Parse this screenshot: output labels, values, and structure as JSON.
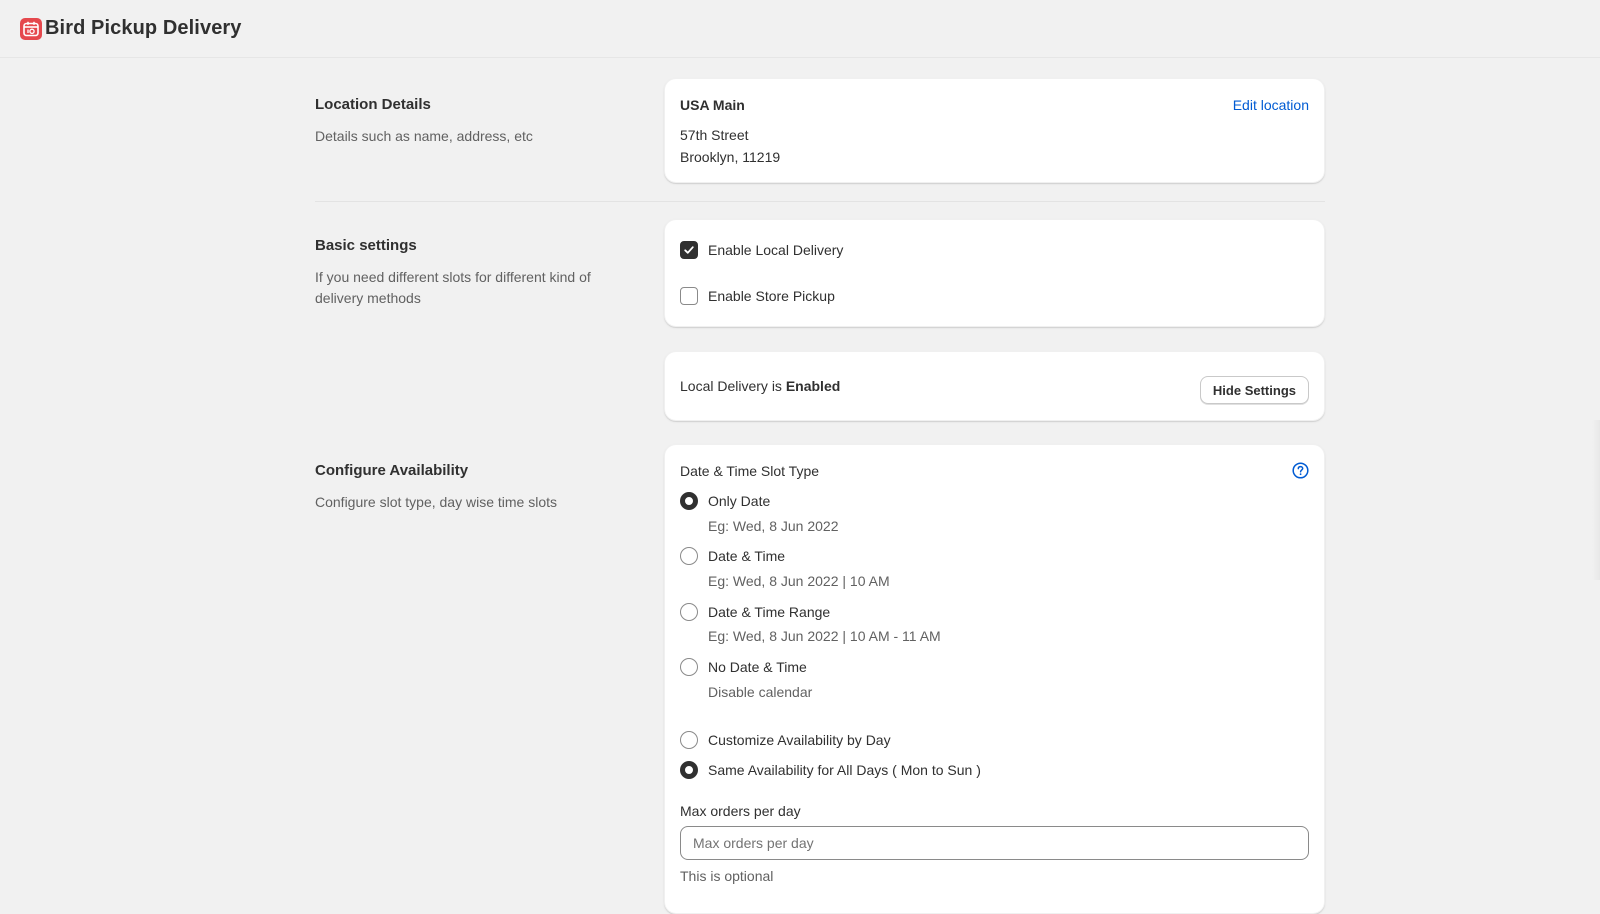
{
  "app": {
    "title": "Bird Pickup Delivery",
    "logo_icon": "calendar-icon",
    "brand_color": "#e5484d"
  },
  "location_section": {
    "title": "Location Details",
    "description": "Details such as name, address, etc",
    "card": {
      "name": "USA Main",
      "edit_label": "Edit location",
      "address_line1": "57th Street",
      "address_line2": "Brooklyn, 11219"
    }
  },
  "basic_section": {
    "title": "Basic settings",
    "description": "If you need different slots for different kind of delivery methods",
    "options": [
      {
        "label": "Enable Local Delivery",
        "checked": true
      },
      {
        "label": "Enable Store Pickup",
        "checked": false
      }
    ]
  },
  "status_card": {
    "prefix": "Local Delivery is",
    "status": "Enabled",
    "button_label": "Hide Settings"
  },
  "availability_section": {
    "title": "Configure Availability",
    "description": "Configure slot type, day wise time slots",
    "card_title": "Date & Time Slot Type",
    "help_icon": "question-circle-icon",
    "slot_types": [
      {
        "label": "Only Date",
        "hint": "Eg: Wed, 8 Jun 2022",
        "selected": true
      },
      {
        "label": "Date & Time",
        "hint": "Eg: Wed, 8 Jun 2022 | 10 AM",
        "selected": false
      },
      {
        "label": "Date & Time Range",
        "hint": "Eg: Wed, 8 Jun 2022 | 10 AM - 11 AM",
        "selected": false
      },
      {
        "label": "No Date & Time",
        "hint": "Disable calendar",
        "selected": false
      }
    ],
    "availability_modes": [
      {
        "label": "Customize Availability by Day",
        "selected": false
      },
      {
        "label": "Same Availability for All Days ( Mon to Sun )",
        "selected": true
      }
    ],
    "max_orders": {
      "label": "Max orders per day",
      "placeholder": "Max orders per day",
      "value": "",
      "help": "This is optional"
    }
  }
}
